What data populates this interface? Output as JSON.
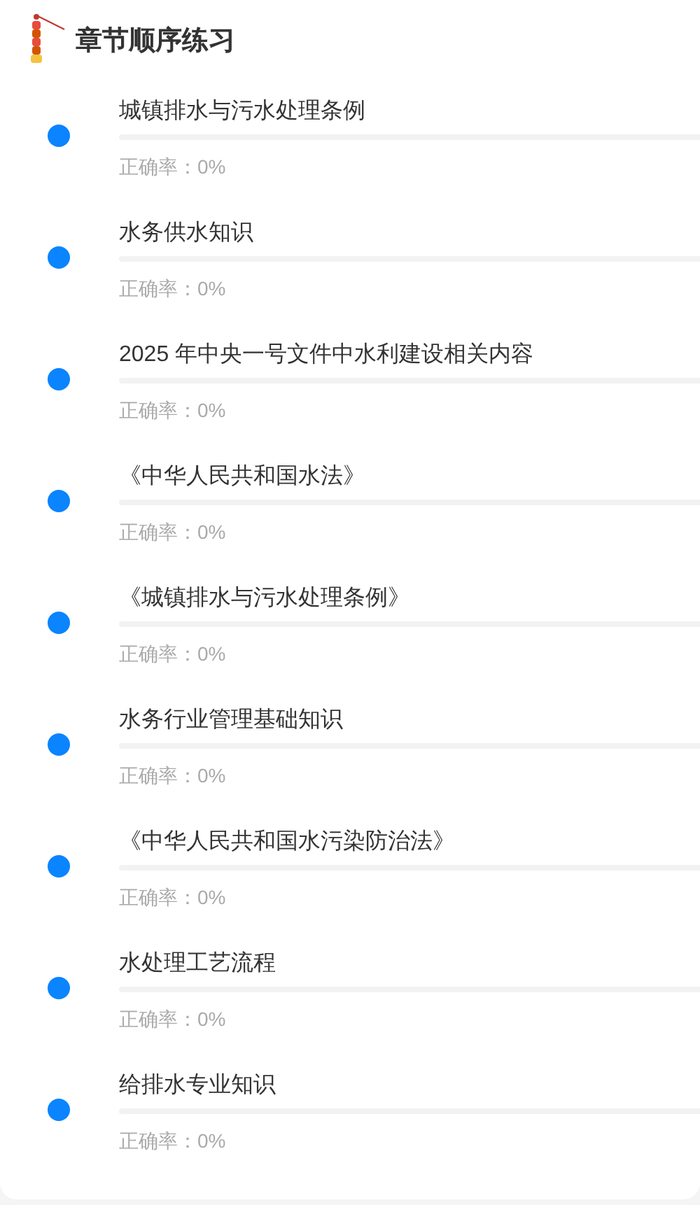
{
  "header": {
    "title": "章节顺序练习"
  },
  "chapters": [
    {
      "title": "城镇排水与污水处理条例",
      "level": 0,
      "accuracy": "正确率：0%"
    },
    {
      "title": "水务供水知识",
      "level": 0,
      "accuracy": "正确率：0%"
    },
    {
      "title": "2025 年中央一号文件中水利建设相关内容",
      "level": 0,
      "accuracy": "正确率：0%"
    },
    {
      "title": "《中华人民共和国水法》",
      "level": 0,
      "accuracy": "正确率：0%"
    },
    {
      "title": "《城镇排水与污水处理条例》",
      "level": 0,
      "accuracy": "正确率：0%"
    },
    {
      "title": "水务行业管理基础知识",
      "level": 0,
      "accuracy": "正确率：0%"
    },
    {
      "title": "《中华人民共和国水污染防治法》",
      "level": 0,
      "accuracy": "正确率：0%"
    },
    {
      "title": "水处理工艺流程",
      "level": 0,
      "accuracy": "正确率：0%"
    },
    {
      "title": "给排水专业知识",
      "level": 0,
      "accuracy": "正确率：0%"
    }
  ]
}
